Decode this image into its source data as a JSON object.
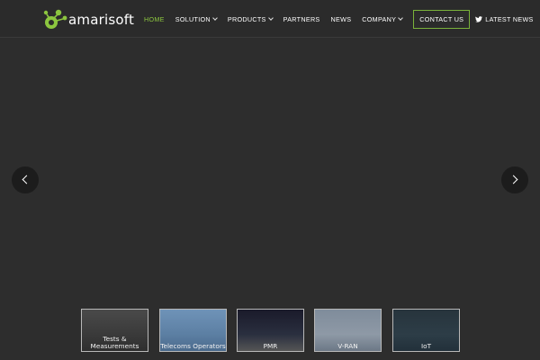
{
  "header": {
    "logo_text": "amarisoft",
    "nav": [
      {
        "label": "HOME",
        "caret": false,
        "active": true
      },
      {
        "label": "SOLUTION",
        "caret": true,
        "active": false
      },
      {
        "label": "PRODUCTS",
        "caret": true,
        "active": false
      },
      {
        "label": "PARTNERS",
        "caret": false,
        "active": false
      },
      {
        "label": "NEWS",
        "caret": false,
        "active": false
      },
      {
        "label": "COMPANY",
        "caret": true,
        "active": false
      },
      {
        "label": "CONTACT US",
        "caret": false,
        "active": false
      },
      {
        "label": "LATEST NEWS",
        "caret": false,
        "active": false
      }
    ]
  },
  "carousel": {
    "prev_icon": "chevron-left-icon",
    "next_icon": "chevron-right-icon"
  },
  "thumbnails": [
    {
      "caption": "Tests & Measurements"
    },
    {
      "caption": "Telecoms Operators"
    },
    {
      "caption": "PMR"
    },
    {
      "caption": "V-RAN"
    },
    {
      "caption": "IoT"
    }
  ],
  "colors": {
    "accent": "#8cc63f",
    "background": "#2d2d2d"
  }
}
